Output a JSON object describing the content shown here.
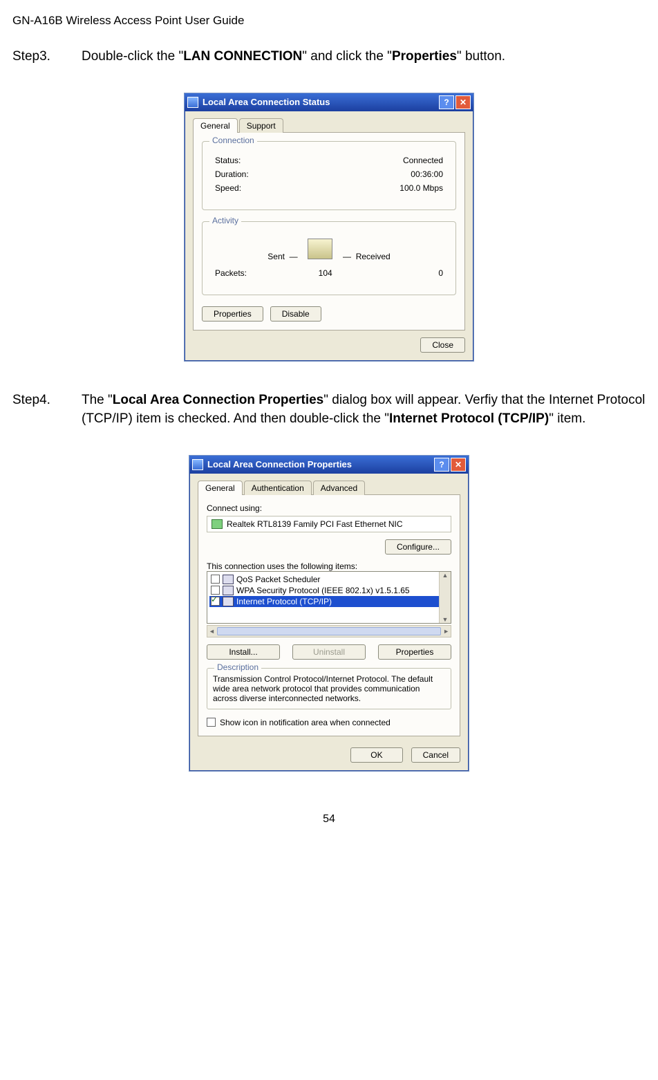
{
  "page_header": "GN-A16B Wireless Access Point User Guide",
  "step3": {
    "label": "Step3.",
    "pre": "Double-click the \"",
    "bold1": "LAN CONNECTION",
    "mid": "\" and click the \"",
    "bold2": "Properties",
    "post": "\" button."
  },
  "status_win": {
    "title": "Local Area Connection Status",
    "tabs": {
      "general": "General",
      "support": "Support"
    },
    "connection": {
      "group": "Connection",
      "status_label": "Status:",
      "status_value": "Connected",
      "duration_label": "Duration:",
      "duration_value": "00:36:00",
      "speed_label": "Speed:",
      "speed_value": "100.0 Mbps"
    },
    "activity": {
      "group": "Activity",
      "sent_label": "Sent",
      "received_label": "Received",
      "packets_label": "Packets:",
      "packets_sent": "104",
      "packets_recv": "0"
    },
    "buttons": {
      "properties": "Properties",
      "disable": "Disable",
      "close": "Close"
    }
  },
  "step4": {
    "label": "Step4.",
    "pre": "The \"",
    "bold1": "Local Area Connection Properties",
    "mid1": "\" dialog box will appear. Verfiy that the Internet Protocol (TCP/IP) item is checked. And then double-click the \"",
    "bold2": "Internet Protocol (TCP/IP)",
    "post": "\" item."
  },
  "props_win": {
    "title": "Local Area Connection Properties",
    "tabs": {
      "general": "General",
      "auth": "Authentication",
      "advanced": "Advanced"
    },
    "connect_using_label": "Connect using:",
    "adapter": "Realtek RTL8139 Family PCI Fast Ethernet NIC",
    "configure_btn": "Configure...",
    "uses_label": "This connection uses the following items:",
    "items": {
      "qos": "QoS Packet Scheduler",
      "wpa": "WPA Security Protocol (IEEE 802.1x) v1.5.1.65",
      "tcpip": "Internet Protocol (TCP/IP)"
    },
    "buttons": {
      "install": "Install...",
      "uninstall": "Uninstall",
      "properties": "Properties"
    },
    "description": {
      "title": "Description",
      "text": "Transmission Control Protocol/Internet Protocol. The default wide area network protocol that provides communication across diverse interconnected networks."
    },
    "show_icon": "Show icon in notification area when connected",
    "ok": "OK",
    "cancel": "Cancel"
  },
  "page_number": "54"
}
